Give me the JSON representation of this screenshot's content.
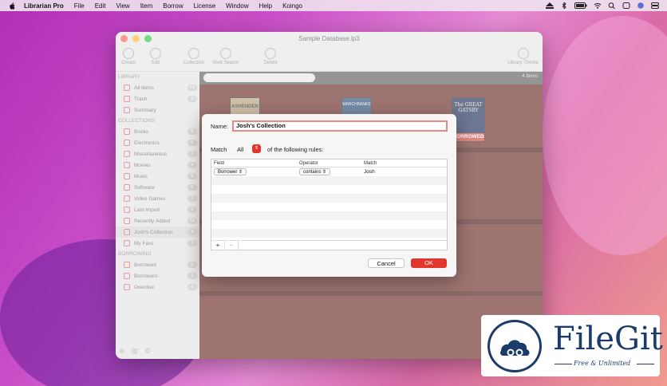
{
  "menubar": {
    "items": [
      "Librarian Pro",
      "File",
      "Edit",
      "View",
      "Item",
      "Borrow",
      "License",
      "Window",
      "Help",
      "Koingo"
    ]
  },
  "window": {
    "title": "Sample Database.lp3",
    "toolbar": [
      {
        "label": "Create",
        "icon": "plus-icon"
      },
      {
        "label": "Edit",
        "icon": "pencil-icon"
      },
      {
        "label": "Collection",
        "icon": "gear-icon"
      },
      {
        "label": "Web Search",
        "icon": "globe-icon"
      },
      {
        "label": "Delete",
        "icon": "trash-icon"
      },
      {
        "label": "Library Theme",
        "icon": "theme-icon"
      }
    ],
    "sidebar": {
      "library_header": "LIBRARY",
      "library": [
        {
          "label": "All Items",
          "count": "13"
        },
        {
          "label": "Trash",
          "count": "0"
        },
        {
          "label": "Summary",
          "count": ""
        }
      ],
      "collections_header": "COLLECTIONS",
      "collections": [
        {
          "label": "Books",
          "count": "8"
        },
        {
          "label": "Electronics",
          "count": "0"
        },
        {
          "label": "Miscellaneous",
          "count": "0"
        },
        {
          "label": "Movies",
          "count": "4"
        },
        {
          "label": "Music",
          "count": "0"
        },
        {
          "label": "Software",
          "count": "0"
        },
        {
          "label": "Video Games",
          "count": "2"
        },
        {
          "label": "Last Import",
          "count": "0"
        },
        {
          "label": "Recently Added",
          "count": "13"
        },
        {
          "label": "Josh's Collection",
          "count": "4"
        },
        {
          "label": "My Favs",
          "count": "7"
        }
      ],
      "borrowing_header": "BORROWING",
      "borrowing": [
        {
          "label": "Borrowed",
          "count": "0"
        },
        {
          "label": "Borrowers",
          "count": "1"
        },
        {
          "label": "Overdue",
          "count": "0"
        }
      ]
    },
    "content": {
      "items_count": "4 Items",
      "book_titles": [
        "ASHENDEN",
        "MARCHBANKS",
        "The GREAT GATSBY"
      ],
      "borrowed_label": "BORROWED"
    }
  },
  "dialog": {
    "name_label": "Name:",
    "name_value": "Josh's Collection",
    "match_label": "Match",
    "match_value": "All",
    "match_suffix": "of the following rules:",
    "columns": [
      "Field",
      "Operator",
      "Match"
    ],
    "rules": [
      {
        "field": "Borrower",
        "operator": "contains",
        "match": "Josh"
      }
    ],
    "add_label": "+",
    "remove_label": "−",
    "cancel_label": "Cancel",
    "ok_label": "OK"
  },
  "watermark": {
    "brand": "FileGit",
    "tagline": "Free & Unlimited"
  },
  "colors": {
    "accent": "#e0362c",
    "brand": "#1c3b6b"
  }
}
